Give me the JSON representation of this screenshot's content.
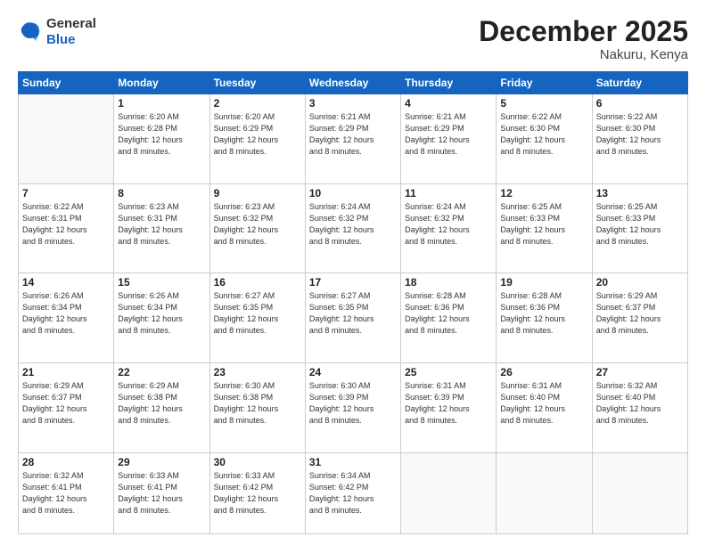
{
  "header": {
    "logo": {
      "general": "General",
      "blue": "Blue"
    },
    "title": "December 2025",
    "location": "Nakuru, Kenya"
  },
  "weekdays": [
    "Sunday",
    "Monday",
    "Tuesday",
    "Wednesday",
    "Thursday",
    "Friday",
    "Saturday"
  ],
  "weeks": [
    [
      {
        "day": "",
        "info": ""
      },
      {
        "day": "1",
        "info": "Sunrise: 6:20 AM\nSunset: 6:28 PM\nDaylight: 12 hours\nand 8 minutes."
      },
      {
        "day": "2",
        "info": "Sunrise: 6:20 AM\nSunset: 6:29 PM\nDaylight: 12 hours\nand 8 minutes."
      },
      {
        "day": "3",
        "info": "Sunrise: 6:21 AM\nSunset: 6:29 PM\nDaylight: 12 hours\nand 8 minutes."
      },
      {
        "day": "4",
        "info": "Sunrise: 6:21 AM\nSunset: 6:29 PM\nDaylight: 12 hours\nand 8 minutes."
      },
      {
        "day": "5",
        "info": "Sunrise: 6:22 AM\nSunset: 6:30 PM\nDaylight: 12 hours\nand 8 minutes."
      },
      {
        "day": "6",
        "info": "Sunrise: 6:22 AM\nSunset: 6:30 PM\nDaylight: 12 hours\nand 8 minutes."
      }
    ],
    [
      {
        "day": "7",
        "info": "Sunrise: 6:22 AM\nSunset: 6:31 PM\nDaylight: 12 hours\nand 8 minutes."
      },
      {
        "day": "8",
        "info": "Sunrise: 6:23 AM\nSunset: 6:31 PM\nDaylight: 12 hours\nand 8 minutes."
      },
      {
        "day": "9",
        "info": "Sunrise: 6:23 AM\nSunset: 6:32 PM\nDaylight: 12 hours\nand 8 minutes."
      },
      {
        "day": "10",
        "info": "Sunrise: 6:24 AM\nSunset: 6:32 PM\nDaylight: 12 hours\nand 8 minutes."
      },
      {
        "day": "11",
        "info": "Sunrise: 6:24 AM\nSunset: 6:32 PM\nDaylight: 12 hours\nand 8 minutes."
      },
      {
        "day": "12",
        "info": "Sunrise: 6:25 AM\nSunset: 6:33 PM\nDaylight: 12 hours\nand 8 minutes."
      },
      {
        "day": "13",
        "info": "Sunrise: 6:25 AM\nSunset: 6:33 PM\nDaylight: 12 hours\nand 8 minutes."
      }
    ],
    [
      {
        "day": "14",
        "info": "Sunrise: 6:26 AM\nSunset: 6:34 PM\nDaylight: 12 hours\nand 8 minutes."
      },
      {
        "day": "15",
        "info": "Sunrise: 6:26 AM\nSunset: 6:34 PM\nDaylight: 12 hours\nand 8 minutes."
      },
      {
        "day": "16",
        "info": "Sunrise: 6:27 AM\nSunset: 6:35 PM\nDaylight: 12 hours\nand 8 minutes."
      },
      {
        "day": "17",
        "info": "Sunrise: 6:27 AM\nSunset: 6:35 PM\nDaylight: 12 hours\nand 8 minutes."
      },
      {
        "day": "18",
        "info": "Sunrise: 6:28 AM\nSunset: 6:36 PM\nDaylight: 12 hours\nand 8 minutes."
      },
      {
        "day": "19",
        "info": "Sunrise: 6:28 AM\nSunset: 6:36 PM\nDaylight: 12 hours\nand 8 minutes."
      },
      {
        "day": "20",
        "info": "Sunrise: 6:29 AM\nSunset: 6:37 PM\nDaylight: 12 hours\nand 8 minutes."
      }
    ],
    [
      {
        "day": "21",
        "info": "Sunrise: 6:29 AM\nSunset: 6:37 PM\nDaylight: 12 hours\nand 8 minutes."
      },
      {
        "day": "22",
        "info": "Sunrise: 6:29 AM\nSunset: 6:38 PM\nDaylight: 12 hours\nand 8 minutes."
      },
      {
        "day": "23",
        "info": "Sunrise: 6:30 AM\nSunset: 6:38 PM\nDaylight: 12 hours\nand 8 minutes."
      },
      {
        "day": "24",
        "info": "Sunrise: 6:30 AM\nSunset: 6:39 PM\nDaylight: 12 hours\nand 8 minutes."
      },
      {
        "day": "25",
        "info": "Sunrise: 6:31 AM\nSunset: 6:39 PM\nDaylight: 12 hours\nand 8 minutes."
      },
      {
        "day": "26",
        "info": "Sunrise: 6:31 AM\nSunset: 6:40 PM\nDaylight: 12 hours\nand 8 minutes."
      },
      {
        "day": "27",
        "info": "Sunrise: 6:32 AM\nSunset: 6:40 PM\nDaylight: 12 hours\nand 8 minutes."
      }
    ],
    [
      {
        "day": "28",
        "info": "Sunrise: 6:32 AM\nSunset: 6:41 PM\nDaylight: 12 hours\nand 8 minutes."
      },
      {
        "day": "29",
        "info": "Sunrise: 6:33 AM\nSunset: 6:41 PM\nDaylight: 12 hours\nand 8 minutes."
      },
      {
        "day": "30",
        "info": "Sunrise: 6:33 AM\nSunset: 6:42 PM\nDaylight: 12 hours\nand 8 minutes."
      },
      {
        "day": "31",
        "info": "Sunrise: 6:34 AM\nSunset: 6:42 PM\nDaylight: 12 hours\nand 8 minutes."
      },
      {
        "day": "",
        "info": ""
      },
      {
        "day": "",
        "info": ""
      },
      {
        "day": "",
        "info": ""
      }
    ]
  ]
}
